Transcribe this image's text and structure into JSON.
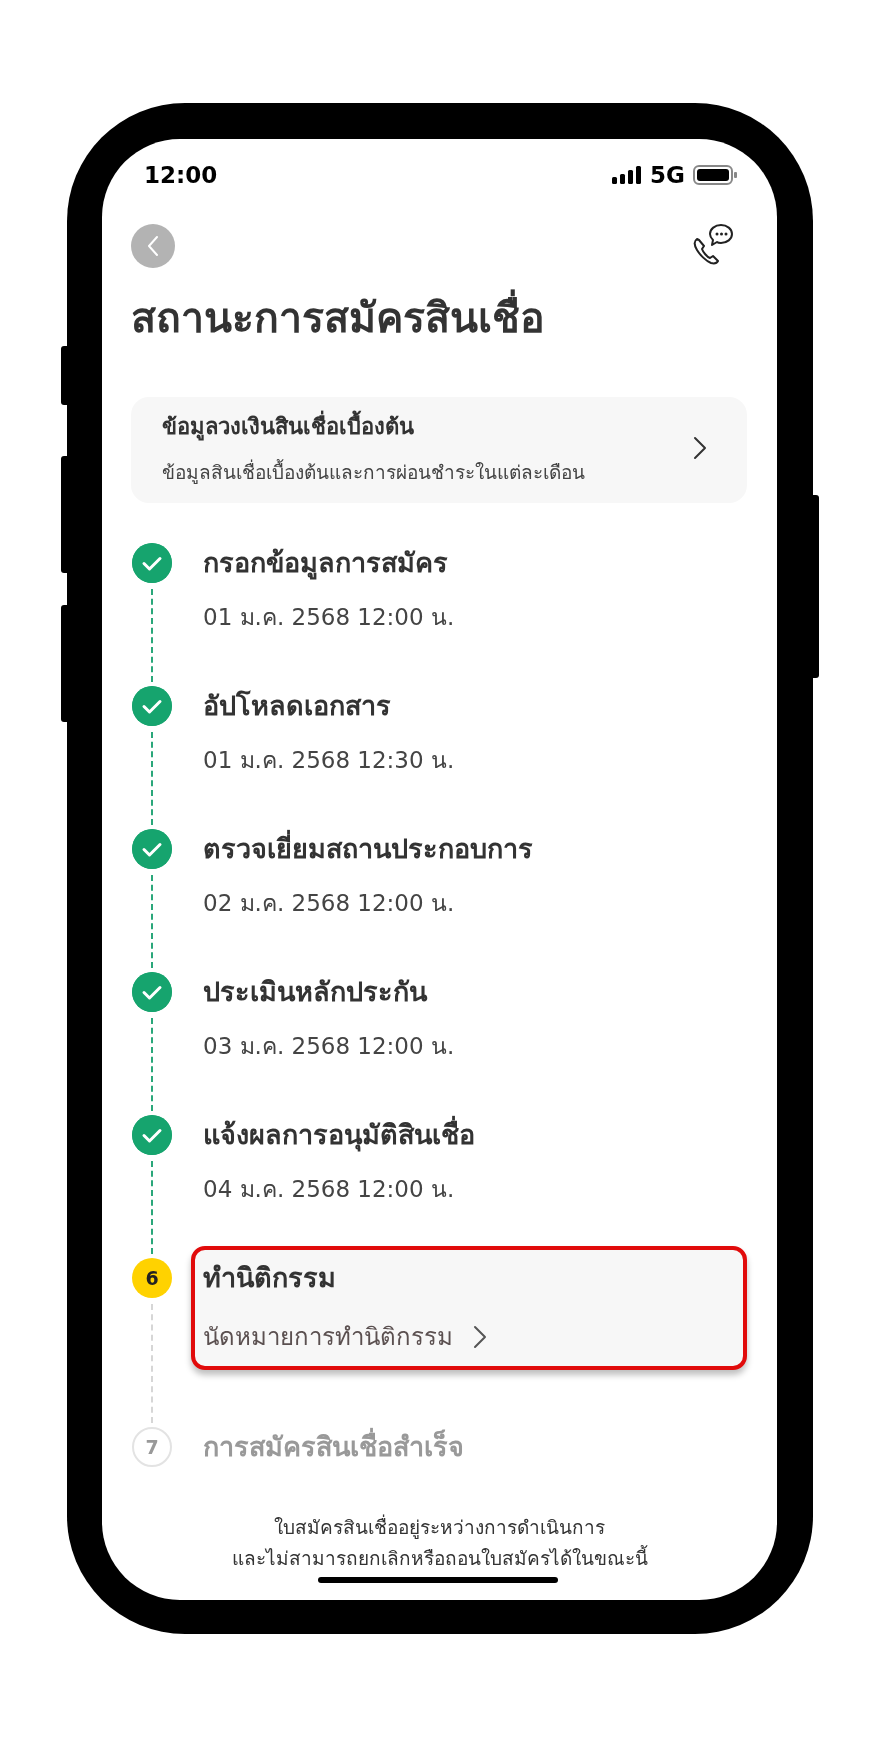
{
  "status_bar": {
    "time": "12:00",
    "network": "5G"
  },
  "header": {
    "title": "สถานะการสมัครสินเชื่อ"
  },
  "summary_card": {
    "title": "ข้อมูลวงเงินสินเชื่อเบื้องต้น",
    "subtitle": "ข้อมูลสินเชื่อเบื้องต้นและการผ่อนชำระในแต่ละเดือน"
  },
  "steps": [
    {
      "kind": "done",
      "title": "กรอกข้อมูลการสมัคร",
      "date": "01 ม.ค. 2568 12:00 น."
    },
    {
      "kind": "done",
      "title": "อัปโหลดเอกสาร",
      "date": "01 ม.ค. 2568 12:30 น."
    },
    {
      "kind": "done",
      "title": "ตรวจเยี่ยมสถานประกอบการ",
      "date": "02 ม.ค. 2568 12:00 น."
    },
    {
      "kind": "done",
      "title": "ประเมินหลักประกัน",
      "date": "03 ม.ค. 2568 12:00 น."
    },
    {
      "kind": "done",
      "title": "แจ้งผลการอนุมัติสินเชื่อ",
      "date": "04 ม.ค. 2568 12:00 น."
    },
    {
      "kind": "current",
      "number": "6",
      "title": "ทำนิติกรรม",
      "action": "นัดหมายการทำนิติกรรม",
      "highlighted": true
    },
    {
      "kind": "pending",
      "number": "7",
      "title": "การสมัครสินเชื่อสำเร็จ"
    }
  ],
  "note": [
    "ใบสมัครสินเชื่ออยู่ระหว่างการดำเนินการ",
    "และไม่สามารถยกเลิกหรือถอนใบสมัครได้ในขณะนี้"
  ]
}
